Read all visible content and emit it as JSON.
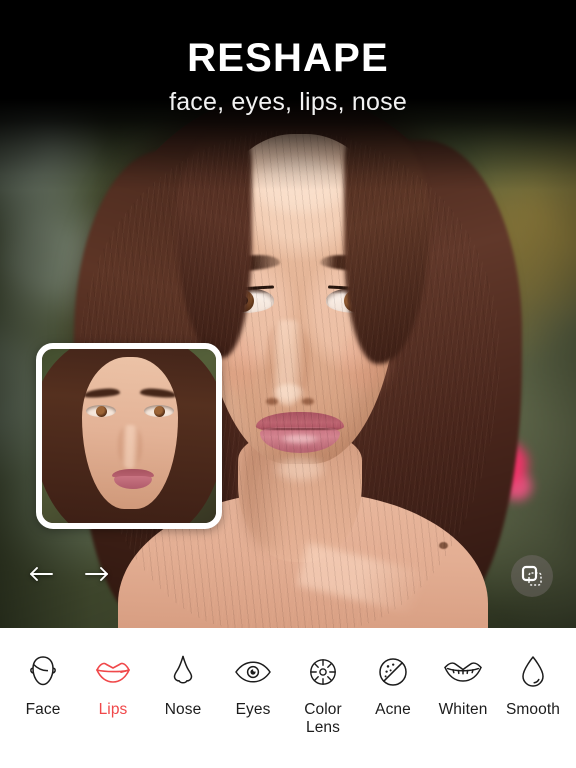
{
  "header": {
    "title": "RESHAPE",
    "subtitle": "face, eyes, lips, nose",
    "title_color": "#ffffff",
    "background_color": "#000000"
  },
  "photo": {
    "alt": "portrait of a woman with long dark brown hair, blurred green foliage and a pink flower in the background",
    "thumbnail_alt": "before preview thumbnail of the same face",
    "thumbnail_border_color": "#ffffff"
  },
  "image_controls": {
    "undo": {
      "label": "←",
      "name": "undo-arrow"
    },
    "redo": {
      "label": "→",
      "name": "redo-arrow"
    },
    "compare": {
      "label": "compare-icon",
      "name": "compare-button"
    }
  },
  "toolbar": {
    "background_color": "#ffffff",
    "active_color": "#f0484a",
    "inactive_color": "#1c1c1c",
    "active_index": 1,
    "items": [
      {
        "label": "Face",
        "icon": "face-icon",
        "active": false
      },
      {
        "label": "Lips",
        "icon": "lips-icon",
        "active": true
      },
      {
        "label": "Nose",
        "icon": "nose-icon",
        "active": false
      },
      {
        "label": "Eyes",
        "icon": "eye-icon",
        "active": false
      },
      {
        "label": "Color\nLens",
        "icon": "color-lens-icon",
        "active": false
      },
      {
        "label": "Acne",
        "icon": "acne-icon",
        "active": false
      },
      {
        "label": "Whiten",
        "icon": "whiten-icon",
        "active": false
      },
      {
        "label": "Smooth",
        "icon": "smooth-icon",
        "active": false
      }
    ]
  }
}
